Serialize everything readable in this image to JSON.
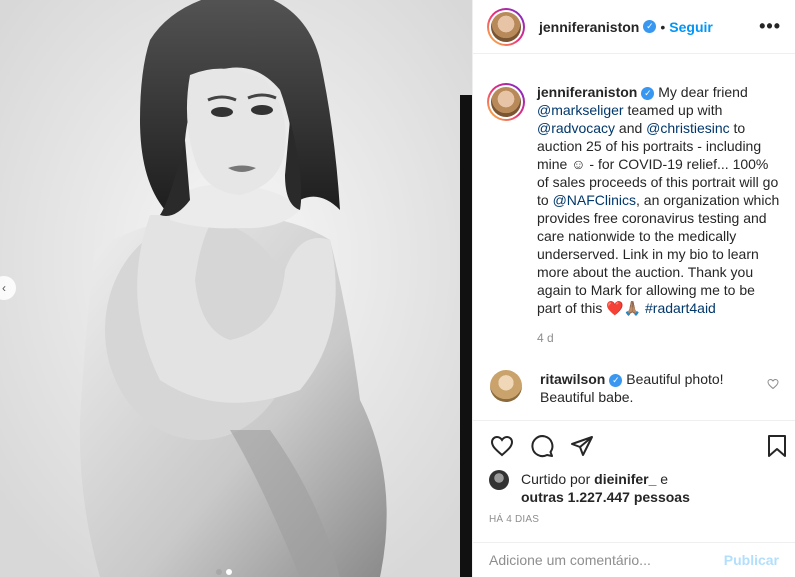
{
  "post": {
    "username": "jenniferaniston",
    "follow_label": "Seguir",
    "more_label": "•••",
    "separator": "•",
    "verified_glyph": "✓"
  },
  "caption": {
    "username": "jenniferaniston",
    "text_1": " My dear friend ",
    "mention_1": "@markseliger",
    "text_2": " teamed up with ",
    "mention_2": "@radvocacy",
    "text_3": " and ",
    "mention_3": "@christiesinc",
    "text_4": " to auction 25 of his portraits - including mine ☺ - for COVID-19 relief... 100% of sales proceeds of this portrait will go to ",
    "mention_4": "@NAFClinics",
    "text_5": ", an organization which provides free coronavirus testing and care nationwide to the medically underserved. Link in my bio to learn more about the auction. Thank you again to Mark for allowing me to be part of this ❤️🙏🏽 ",
    "hashtag": "#radart4aid",
    "age": "4 d"
  },
  "comment": {
    "username": "ritawilson",
    "text": " Beautiful photo! Beautiful babe."
  },
  "likes": {
    "prefix": "Curtido por ",
    "user": "dieinifer_",
    "middle": " e ",
    "others": "outras 1.227.447 pessoas"
  },
  "timestamp": "HÁ 4 DIAS",
  "add_comment": {
    "placeholder": "Adicione um comentário...",
    "publish_label": "Publicar"
  },
  "carousel": {
    "prev_glyph": "‹"
  },
  "icons": {
    "like": "heart-icon",
    "comment": "comment-icon",
    "share": "share-icon",
    "save": "bookmark-icon"
  },
  "colors": {
    "link_blue": "#0095f6",
    "mention": "#00376b",
    "muted": "#8e8e8e",
    "verified": "#3897f0"
  }
}
